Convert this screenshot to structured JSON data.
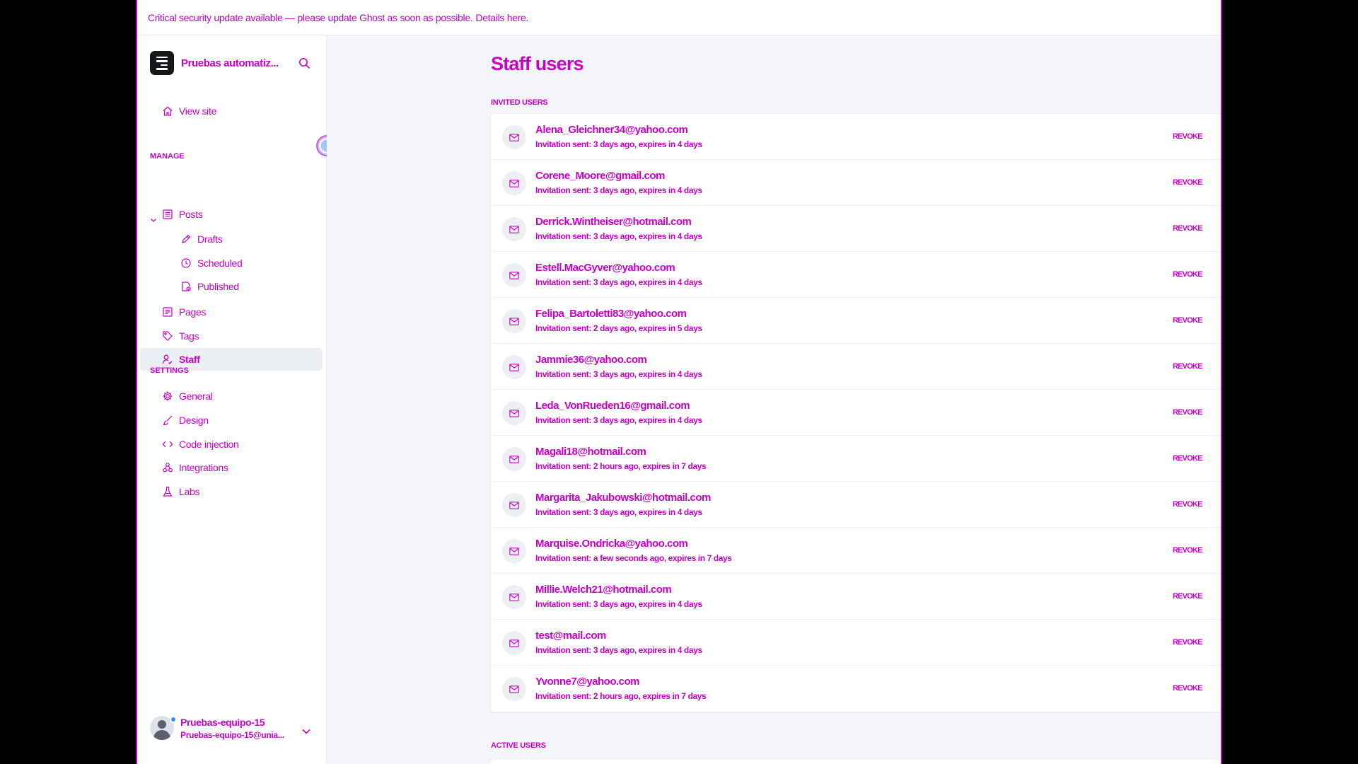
{
  "banner": {
    "text": "Critical security update available — please update Ghost as soon as possible.",
    "link": "Details here."
  },
  "sidebar": {
    "brand": "Pruebas automatiz...",
    "view_site": "View site",
    "manage_title": "MANAGE",
    "settings_title": "SETTINGS",
    "manage_items": {
      "posts": "Posts",
      "drafts": "Drafts",
      "scheduled": "Scheduled",
      "published": "Published",
      "pages": "Pages",
      "tags": "Tags",
      "staff": "Staff"
    },
    "settings_items": {
      "general": "General",
      "design": "Design",
      "code_injection": "Code injection",
      "integrations": "Integrations",
      "labs": "Labs"
    },
    "user": {
      "name": "Pruebas-equipo-15",
      "email": "Pruebas-equipo-15@unia..."
    }
  },
  "main": {
    "title": "Staff users",
    "invited_label": "INVITED USERS",
    "active_label": "ACTIVE USERS",
    "revoke_label": "REVOKE",
    "invited": [
      {
        "email": "Alena_Gleichner34@yahoo.com",
        "status": "Invitation sent: 3 days ago, expires in 4 days"
      },
      {
        "email": "Corene_Moore@gmail.com",
        "status": "Invitation sent: 3 days ago, expires in 4 days"
      },
      {
        "email": "Derrick.Wintheiser@hotmail.com",
        "status": "Invitation sent: 3 days ago, expires in 4 days"
      },
      {
        "email": "Estell.MacGyver@yahoo.com",
        "status": "Invitation sent: 3 days ago, expires in 4 days"
      },
      {
        "email": "Felipa_Bartoletti83@yahoo.com",
        "status": "Invitation sent: 2 days ago, expires in 5 days"
      },
      {
        "email": "Jammie36@yahoo.com",
        "status": "Invitation sent: 3 days ago, expires in 4 days"
      },
      {
        "email": "Leda_VonRueden16@gmail.com",
        "status": "Invitation sent: 3 days ago, expires in 4 days"
      },
      {
        "email": "Magali18@hotmail.com",
        "status": "Invitation sent: 2 hours ago, expires in 7 days"
      },
      {
        "email": "Margarita_Jakubowski@hotmail.com",
        "status": "Invitation sent: 3 days ago, expires in 4 days"
      },
      {
        "email": "Marquise.Ondricka@yahoo.com",
        "status": "Invitation sent: a few seconds ago, expires in 7 days"
      },
      {
        "email": "Millie.Welch21@hotmail.com",
        "status": "Invitation sent: 3 days ago, expires in 4 days"
      },
      {
        "email": "test@mail.com",
        "status": "Invitation sent: 3 days ago, expires in 4 days"
      },
      {
        "email": "Yvonne7@yahoo.com",
        "status": "Invitation sent: 2 hours ago, expires in 7 days"
      }
    ]
  },
  "colors": {
    "text": "#c800c8",
    "sidebar_active": "#ebeef3",
    "main_bg": "#f4f5f8"
  }
}
